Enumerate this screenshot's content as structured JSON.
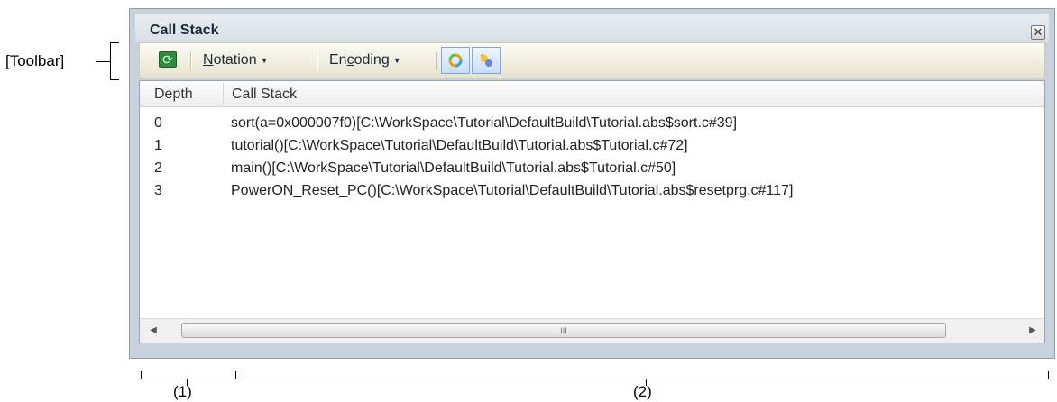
{
  "annotations": {
    "toolbar_label": "[Toolbar]",
    "label_1": "(1)",
    "label_2": "(2)"
  },
  "window": {
    "title": "Call Stack",
    "close_icon": "close-icon"
  },
  "toolbar": {
    "refresh_icon": "refresh-icon",
    "notation": {
      "label_prefix": "",
      "mnemonic": "N",
      "label_suffix": "otation"
    },
    "encoding": {
      "label_prefix": "En",
      "mnemonic": "c",
      "label_suffix": "oding"
    },
    "toggle_icons": [
      "view-a-icon",
      "view-b-icon"
    ]
  },
  "table": {
    "columns": [
      "Depth",
      "Call Stack"
    ],
    "rows": [
      {
        "depth": "0",
        "call": "sort(a=0x000007f0)[C:\\WorkSpace\\Tutorial\\DefaultBuild\\Tutorial.abs$sort.c#39]"
      },
      {
        "depth": "1",
        "call": "tutorial()[C:\\WorkSpace\\Tutorial\\DefaultBuild\\Tutorial.abs$Tutorial.c#72]"
      },
      {
        "depth": "2",
        "call": "main()[C:\\WorkSpace\\Tutorial\\DefaultBuild\\Tutorial.abs$Tutorial.c#50]"
      },
      {
        "depth": "3",
        "call": "PowerON_Reset_PC()[C:\\WorkSpace\\Tutorial\\DefaultBuild\\Tutorial.abs$resetprg.c#117]"
      }
    ]
  },
  "scrollbar": {
    "grip": "III"
  },
  "colors": {
    "window_bg": "#c7d2dd",
    "toolbar_bg": "#e6e3cf",
    "toggle_border": "#7fa9d9"
  }
}
